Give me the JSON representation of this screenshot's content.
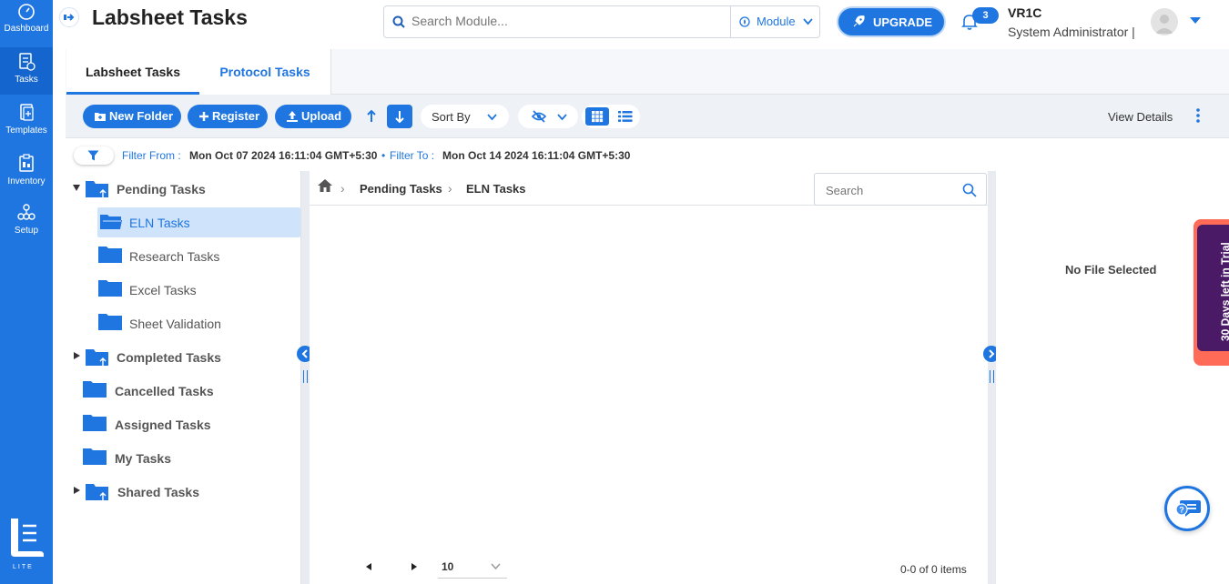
{
  "sidebar": {
    "items": [
      {
        "label": "Dashboard",
        "icon": "gauge-icon"
      },
      {
        "label": "Tasks",
        "icon": "tasks-icon"
      },
      {
        "label": "Templates",
        "icon": "templates-icon"
      },
      {
        "label": "Inventory",
        "icon": "inventory-icon"
      },
      {
        "label": "Setup",
        "icon": "setup-icon"
      }
    ],
    "logo_text": "LITE"
  },
  "header": {
    "title": "Labsheet Tasks",
    "search_placeholder": "Search Module...",
    "module_label": "Module",
    "upgrade_label": "UPGRADE",
    "notification_count": "3",
    "user_name": "VR1C",
    "user_role": "System Administrator |"
  },
  "tabs": [
    {
      "label": "Labsheet Tasks",
      "active": true
    },
    {
      "label": "Protocol Tasks",
      "active": false
    }
  ],
  "toolbar": {
    "new_folder": "New Folder",
    "register": "Register",
    "upload": "Upload",
    "sort_by": "Sort By",
    "view_details": "View Details"
  },
  "filter": {
    "from_label": "Filter From :",
    "from_value": "Mon Oct 07 2024 16:11:04 GMT+5:30",
    "separator": "•",
    "to_label": "Filter To :",
    "to_value": "Mon Oct 14 2024 16:11:04 GMT+5:30"
  },
  "tree": {
    "items": [
      {
        "label": "Pending Tasks",
        "level": 0,
        "expanded": true
      },
      {
        "label": "ELN Tasks",
        "level": 1,
        "selected": true
      },
      {
        "label": "Research Tasks",
        "level": 1
      },
      {
        "label": "Excel Tasks",
        "level": 1
      },
      {
        "label": "Sheet Validation",
        "level": 1
      },
      {
        "label": "Completed Tasks",
        "level": 0,
        "expanded": false
      },
      {
        "label": "Cancelled Tasks",
        "level": 0
      },
      {
        "label": "Assigned Tasks",
        "level": 0
      },
      {
        "label": "My Tasks",
        "level": 0
      },
      {
        "label": "Shared Tasks",
        "level": 0,
        "expanded": false
      }
    ]
  },
  "breadcrumb": [
    "Pending Tasks",
    "ELN Tasks"
  ],
  "pane_search_placeholder": "Search",
  "pager": {
    "page_size": "10",
    "info": "0-0 of 0 items"
  },
  "details": {
    "empty_text": "No File Selected"
  },
  "trial_text": "30 Days left in Trial",
  "colors": {
    "primary": "#1f76e0",
    "trial_accent": "#ff6b57",
    "trial_bg": "#4a1a67"
  }
}
